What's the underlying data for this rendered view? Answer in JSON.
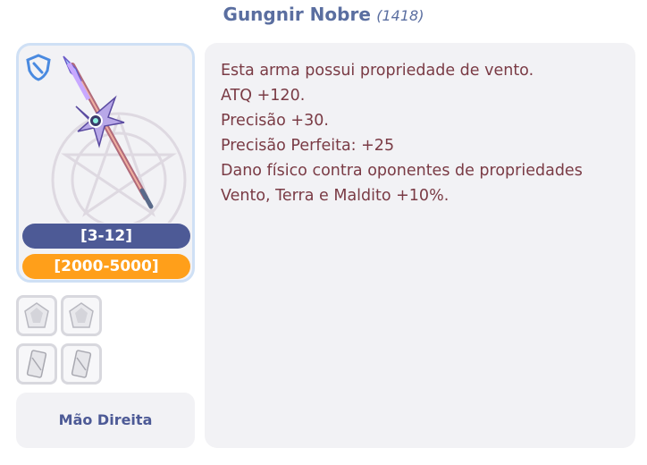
{
  "item": {
    "name": "Gungnir Nobre",
    "id": "(1418)"
  },
  "card": {
    "range_primary": "[3-12]",
    "range_secondary": "[2000-5000]"
  },
  "slots": [
    {
      "icon": "gem-icon"
    },
    {
      "icon": "gem-icon"
    },
    {
      "icon": "card-icon"
    },
    {
      "icon": "card-icon"
    }
  ],
  "location": "Mão Direita",
  "description": [
    "Esta arma possui propriedade de vento.",
    "ATQ +120.",
    "Precisão +30.",
    "Precisão Perfeita: +25",
    "Dano físico contra oponentes de propriedades",
    "Vento, Terra e Maldito +10%."
  ],
  "colors": {
    "title": "#5a6ea0",
    "range_primary_bg": "#4d5a96",
    "range_secondary_bg": "#ff9f1a",
    "description_text": "#7a3b45"
  }
}
